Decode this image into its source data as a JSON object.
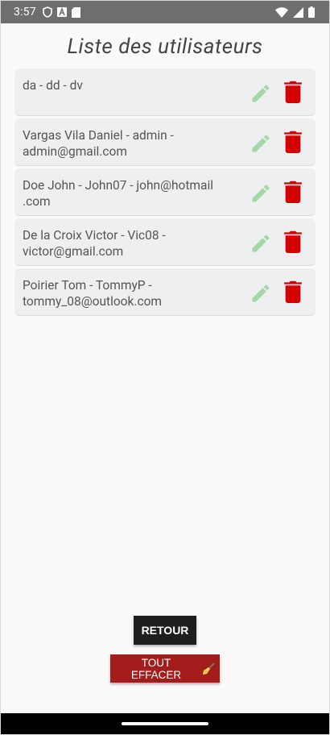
{
  "status_bar": {
    "time": "3:57"
  },
  "page": {
    "title": "Liste des utilisateurs"
  },
  "users": [
    "da - dd - dv",
    "Vargas Vila Daniel - admin - admin@gmail.com",
    "Doe John - John07 - john@hotmail .com",
    "De la Croix Victor - Vic08 - victor@gmail.com",
    "Poirier Tom - TommyP - tommy_08@outlook.com"
  ],
  "actions": {
    "back_label": "RETOUR",
    "clear_all_label": "TOUT EFFACER",
    "clear_all_icon": "broom-emoji"
  },
  "colors": {
    "edit_icon": "#a5d6a7",
    "delete_icon": "#d50000",
    "clear_button": "#a41d1d",
    "back_button": "#1e1e1e"
  }
}
